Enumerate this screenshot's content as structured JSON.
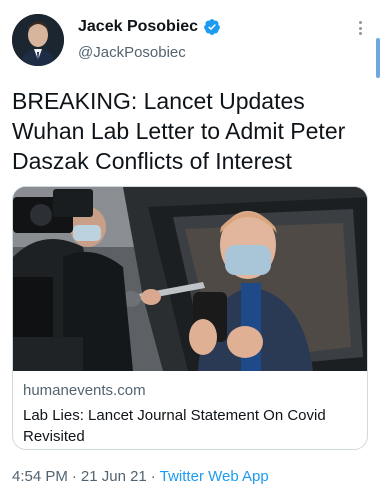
{
  "author": {
    "display_name": "Jacek Posobiec",
    "handle": "@JackPosobiec",
    "verified": true
  },
  "tweet": {
    "text": "BREAKING: Lancet Updates Wuhan Lab Letter to Admit Peter Daszak Conflicts of Interest"
  },
  "link_card": {
    "domain": "humanevents.com",
    "title": "Lab Lies: Lancet Journal Statement On Covid Revisited"
  },
  "meta": {
    "time": "4:54 PM",
    "date": "21 Jun 21",
    "separator": "·",
    "source": "Twitter Web App"
  },
  "colors": {
    "accent": "#1d9bf0",
    "secondary_text": "#536471",
    "border": "#cfd9de"
  },
  "icons": {
    "verified": "verified-badge-icon",
    "more": "more-options-icon"
  }
}
